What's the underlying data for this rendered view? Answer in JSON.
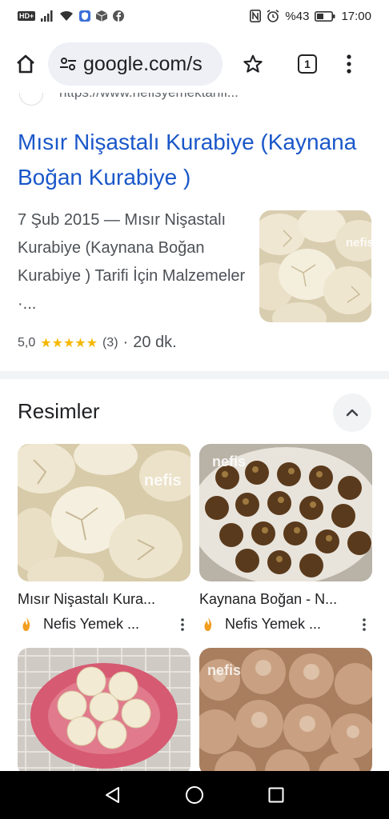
{
  "status_bar": {
    "time": "17:00",
    "battery": "%43",
    "hd_badge": "HD+"
  },
  "browser": {
    "url": "google.com/s",
    "tab_count": "1"
  },
  "prev_result": {
    "url": "https://www.nefisyemektarifl..."
  },
  "result": {
    "title": "Mısır Nişastalı Kurabiye (Kaynana Boğan Kurabiye )",
    "snippet": "7 Şub 2015 — Mısır Nişastalı Kurabiye (Kaynana Boğan Kurabiye ) Tarifi İçin Malzemeler ·...",
    "rating": "5,0",
    "stars": "★★★★★",
    "reviews": "(3)",
    "separator": "·",
    "duration": "20 dk."
  },
  "images_section": {
    "title": "Resimler",
    "cards": [
      {
        "title": "Mısır Nişastalı Kura...",
        "source": "Nefis Yemek ..."
      },
      {
        "title": "Kaynana Boğan - N...",
        "source": "Nefis Yemek ..."
      },
      {
        "title": "",
        "source": ""
      },
      {
        "title": "",
        "source": ""
      }
    ]
  },
  "watermark": "nefis",
  "colors": {
    "link": "#1a57c9",
    "star": "#f5b800",
    "source_favicon": "#f29e1f"
  }
}
